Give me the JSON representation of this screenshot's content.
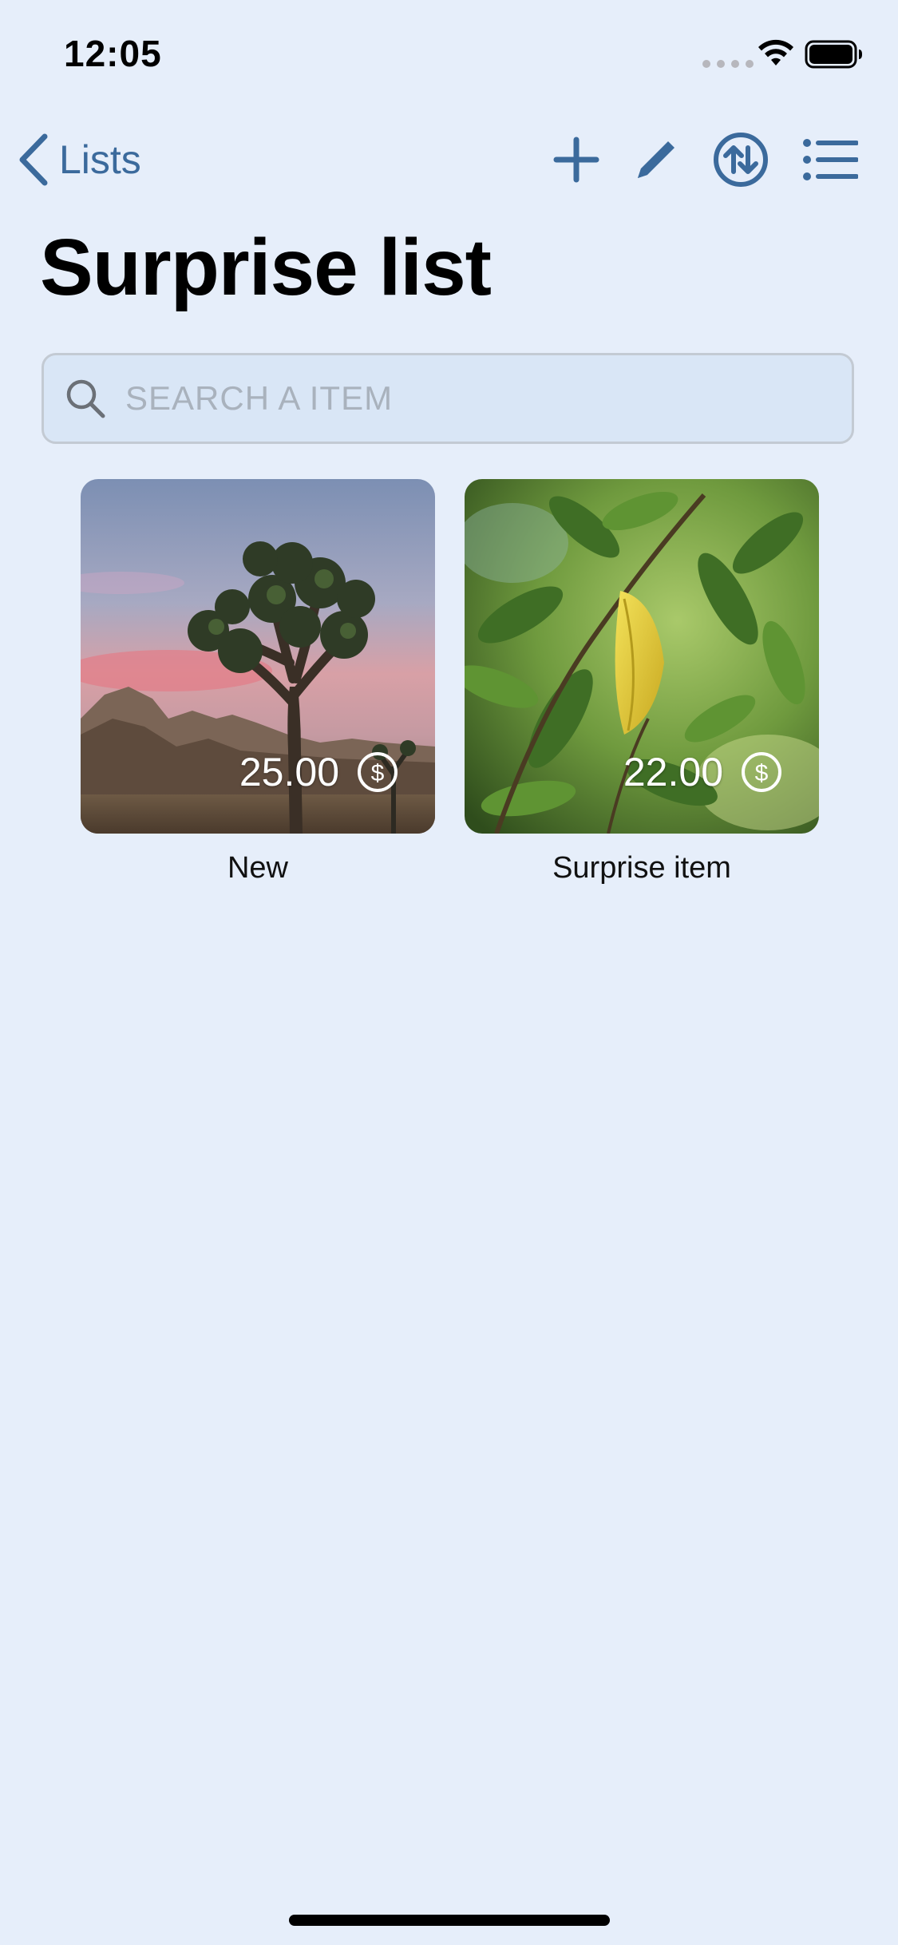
{
  "status_bar": {
    "time": "12:05"
  },
  "nav": {
    "back_label": "Lists",
    "icons": [
      "add-icon",
      "edit-pencil-icon",
      "sort-icon",
      "list-view-icon"
    ],
    "accent_color": "#3b6a9c"
  },
  "page": {
    "title": "Surprise list"
  },
  "search": {
    "placeholder": "SEARCH A ITEM",
    "value": ""
  },
  "items": [
    {
      "name": "New",
      "price": "25.00",
      "currency_icon": "dollar-circle-icon",
      "image": "joshua-tree-desert-photo"
    },
    {
      "name": "Surprise item",
      "price": "22.00",
      "currency_icon": "dollar-circle-icon",
      "image": "green-leaves-photo"
    }
  ],
  "colors": {
    "background": "#e6eefa",
    "search_background": "#d9e6f6"
  }
}
